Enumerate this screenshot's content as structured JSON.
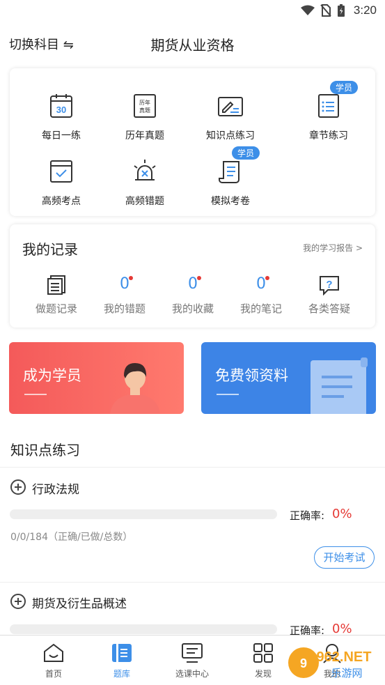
{
  "status": {
    "time": "3:20"
  },
  "header": {
    "switch_label": "切换科目 ⇋",
    "title": "期货从业资格"
  },
  "grid": {
    "badge": "学员",
    "items": [
      {
        "label": "每日一练",
        "icon_text": "30"
      },
      {
        "label": "历年真题",
        "icon_text": "历年真题"
      },
      {
        "label": "知识点练习"
      },
      {
        "label": "章节练习"
      },
      {
        "label": "高频考点"
      },
      {
        "label": "高频错题"
      },
      {
        "label": "模拟考卷"
      }
    ]
  },
  "records": {
    "title": "我的记录",
    "link": "我的学习报告 >",
    "items": [
      {
        "label": "做题记录"
      },
      {
        "label": "我的错题",
        "value": "0"
      },
      {
        "label": "我的收藏",
        "value": "0"
      },
      {
        "label": "我的笔记",
        "value": "0"
      },
      {
        "label": "各类答疑",
        "icon_text": "?"
      }
    ]
  },
  "banners": {
    "left": {
      "title": "成为学员",
      "color": "#f45a5a"
    },
    "right": {
      "title": "免费领资料",
      "color": "#3d84e6"
    }
  },
  "section": {
    "title": "知识点练习"
  },
  "topics": [
    {
      "name": "行政法规",
      "rate_label": "正确率:",
      "rate": "0%",
      "stats": "0/0/184（正确/已做/总数）",
      "button": "开始考试"
    },
    {
      "name": "期货及衍生品概述",
      "rate_label": "正确率:",
      "rate": "0%"
    }
  ],
  "tabbar": {
    "tabs": [
      {
        "label": "首页"
      },
      {
        "label": "题库"
      },
      {
        "label": "选课中心"
      },
      {
        "label": "发现"
      },
      {
        "label": "我的"
      }
    ]
  },
  "watermark": {
    "text": "962.NET",
    "sub": "乐游网"
  },
  "colors": {
    "accent": "#3d8fe8",
    "red": "#e53935"
  }
}
